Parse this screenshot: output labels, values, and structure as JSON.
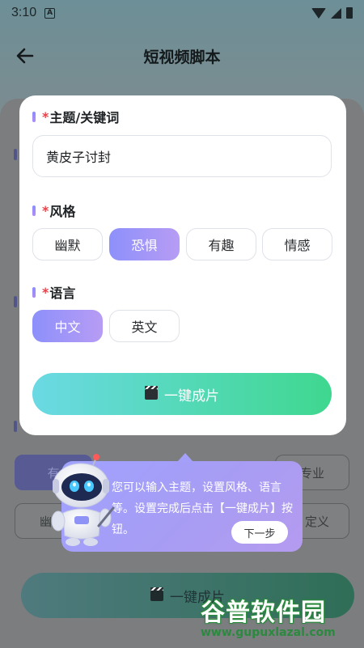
{
  "status_bar": {
    "time": "3:10",
    "notification_glyph": "A"
  },
  "header": {
    "title": "短视频脚本"
  },
  "modal": {
    "topic": {
      "required_mark": "*",
      "label": "主题/关键词",
      "value": "黄皮子讨封"
    },
    "style": {
      "required_mark": "*",
      "label": "风格",
      "options": [
        "幽默",
        "恐惧",
        "有趣",
        "情感"
      ],
      "selected": "恐惧"
    },
    "language": {
      "required_mark": "*",
      "label": "语言",
      "options": [
        "中文",
        "英文"
      ],
      "selected": "中文"
    },
    "create_button": {
      "label": "一键成片"
    }
  },
  "background": {
    "chip_row1": [
      "有",
      "专业"
    ],
    "chip_row2": [
      "幽默",
      "定义"
    ],
    "button_label": "一键成片"
  },
  "tooltip": {
    "text": "您可以输入主题，设置风格、语言等。设置完成后点击【一键成片】按钮。",
    "next_label": "下一步"
  },
  "watermark": {
    "logo_text": "谷普软件园",
    "url": "www.gupuxlazal.com"
  },
  "colors": {
    "accent_start": "#8d90fb",
    "accent_end": "#b79cf4",
    "button_start": "#6bd9e4",
    "button_end": "#3fd78f",
    "required": "#e8424a"
  },
  "icons": [
    "back-arrow-icon",
    "clapper-icon",
    "wifi-icon",
    "signal-icon",
    "battery-icon",
    "robot-mascot"
  ]
}
